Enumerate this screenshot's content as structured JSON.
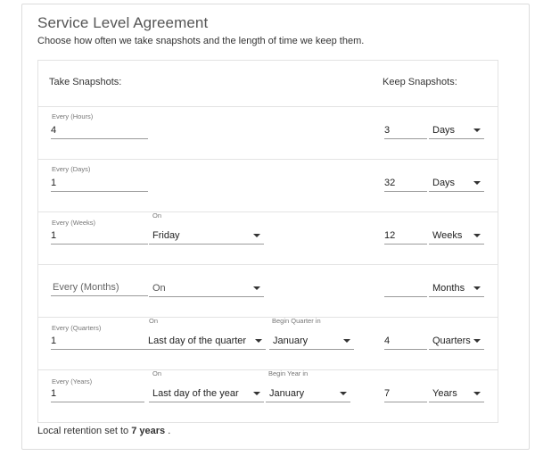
{
  "header": {
    "title": "Service Level Agreement",
    "subtitle": "Choose how often we take snapshots and the length of time we keep them."
  },
  "columns": {
    "take": "Take Snapshots:",
    "keep": "Keep Snapshots:"
  },
  "rows": {
    "hours": {
      "label": "Every (Hours)",
      "value": "4",
      "keep_value": "3",
      "keep_unit": "Days"
    },
    "days": {
      "label": "Every (Days)",
      "value": "1",
      "keep_value": "32",
      "keep_unit": "Days"
    },
    "weeks": {
      "label": "Every (Weeks)",
      "value": "1",
      "on_label": "On",
      "on_value": "Friday",
      "keep_value": "12",
      "keep_unit": "Weeks"
    },
    "months": {
      "placeholder": "Every (Months)",
      "on_placeholder": "On",
      "keep_value": "",
      "keep_unit": "Months"
    },
    "quarters": {
      "label": "Every (Quarters)",
      "value": "1",
      "on_label": "On",
      "on_value": "Last day of the quarter",
      "begin_label": "Begin Quarter in",
      "begin_value": "January",
      "keep_value": "4",
      "keep_unit": "Quarters"
    },
    "years": {
      "label": "Every (Years)",
      "value": "1",
      "on_label": "On",
      "on_value": "Last day of the year",
      "begin_label": "Begin Year in",
      "begin_value": "January",
      "keep_value": "7",
      "keep_unit": "Years"
    }
  },
  "footer": {
    "prefix": "Local retention set to",
    "value": "7 years",
    "suffix": "."
  },
  "icons": {
    "dropdown": "chevron-down-icon"
  }
}
